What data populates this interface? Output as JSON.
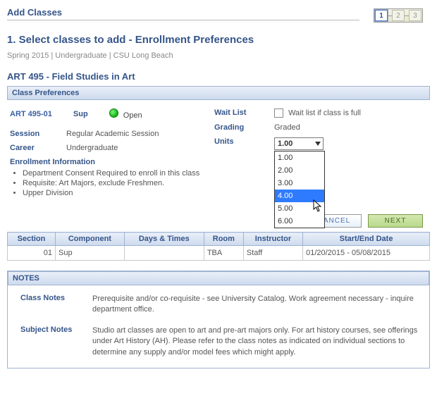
{
  "header": {
    "page_title": "Add Classes",
    "steps": [
      "1",
      "2",
      "3"
    ],
    "active_step": 0,
    "section_head": "1.  Select classes to add - Enrollment Preferences",
    "context": "Spring 2015 | Undergraduate | CSU Long Beach",
    "course_title": "ART  495 - Field Studies in Art"
  },
  "prefs": {
    "bar": "Class Preferences",
    "class_link": "ART  495-01",
    "component": "Sup",
    "status_text": "Open",
    "session_label": "Session",
    "session_value": "Regular Academic Session",
    "career_label": "Career",
    "career_value": "Undergraduate",
    "enroll_header": "Enrollment Information",
    "info_items": [
      "Department Consent Required to enroll in this class",
      "Requisite: Art Majors, exclude Freshmen.",
      "Upper Division"
    ]
  },
  "options": {
    "waitlist_label": "Wait List",
    "waitlist_text": "Wait list if class is full",
    "grading_label": "Grading",
    "grading_value": "Graded",
    "units_label": "Units",
    "units_selected": "1.00",
    "units_options": [
      "1.00",
      "2.00",
      "3.00",
      "4.00",
      "5.00",
      "6.00"
    ],
    "units_highlight": "4.00"
  },
  "buttons": {
    "cancel": "CANCEL",
    "next": "NEXT"
  },
  "table": {
    "headers": [
      "Section",
      "Component",
      "Days & Times",
      "Room",
      "Instructor",
      "Start/End Date"
    ],
    "row": {
      "section": "01",
      "component": "Sup",
      "days": "",
      "room": "TBA",
      "instructor": "Staff",
      "dates": "01/20/2015 - 05/08/2015"
    }
  },
  "notes": {
    "bar": "NOTES",
    "class_label": "Class Notes",
    "class_text": "Prerequisite and/or co-requisite - see University Catalog.  Work agreement necessary - inquire department office.",
    "subject_label": "Subject Notes",
    "subject_text": "Studio art classes are open to art and pre-art majors only.  For art history courses, see offerings under Art History (AH). Please refer to the class notes as indicated on individual sections to determine any supply and/or model fees which might apply."
  }
}
